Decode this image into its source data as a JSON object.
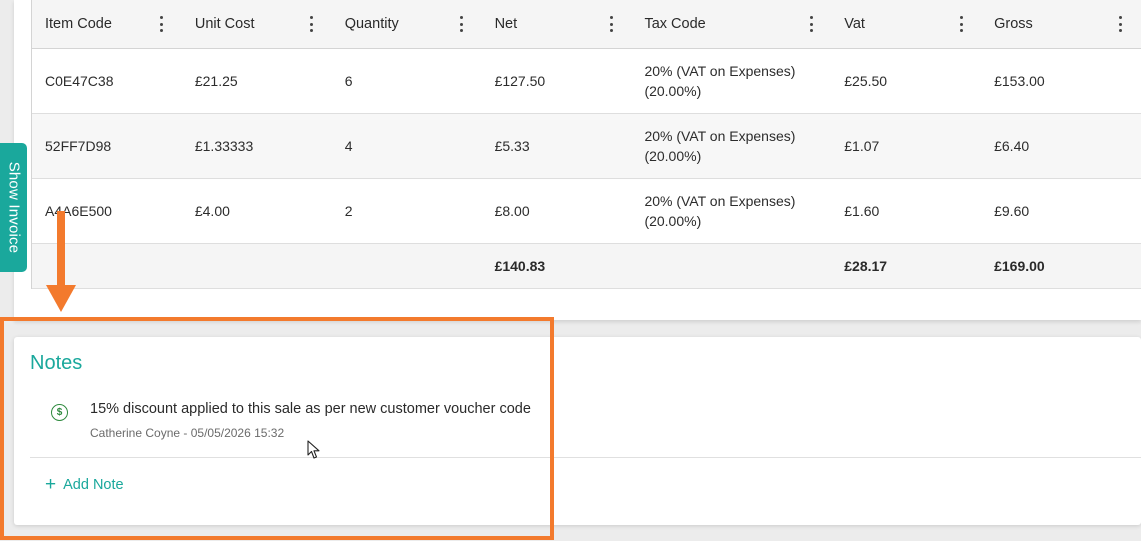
{
  "table": {
    "columns": [
      "Item Code",
      "Unit Cost",
      "Quantity",
      "Net",
      "Tax Code",
      "Vat",
      "Gross"
    ],
    "rows": [
      {
        "item_code": "C0E47C38",
        "unit_cost": "£21.25",
        "quantity": "6",
        "net": "£127.50",
        "tax_code": "20% (VAT on Expenses)\n(20.00%)",
        "vat": "£25.50",
        "gross": "£153.00"
      },
      {
        "item_code": "52FF7D98",
        "unit_cost": "£1.33333",
        "quantity": "4",
        "net": "£5.33",
        "tax_code": "20% (VAT on Expenses)\n(20.00%)",
        "vat": "£1.07",
        "gross": "£6.40"
      },
      {
        "item_code": "A4A6E500",
        "unit_cost": "£4.00",
        "quantity": "2",
        "net": "£8.00",
        "tax_code": "20% (VAT on Expenses)\n(20.00%)",
        "vat": "£1.60",
        "gross": "£9.60"
      }
    ],
    "totals": {
      "net": "£140.83",
      "vat": "£28.17",
      "gross": "£169.00"
    }
  },
  "side_tab": {
    "label": "Show Invoice"
  },
  "notes": {
    "title": "Notes",
    "items": [
      {
        "icon": "dollar-circle-icon",
        "text": "15% discount applied to this sale as per new customer voucher code",
        "meta": "Catherine Coyne - 05/05/2026 15:32"
      }
    ],
    "add_label": "Add Note"
  },
  "colors": {
    "accent": "#1aa89c",
    "highlight": "#f37a2d",
    "note_icon": "#2e8a3e"
  }
}
